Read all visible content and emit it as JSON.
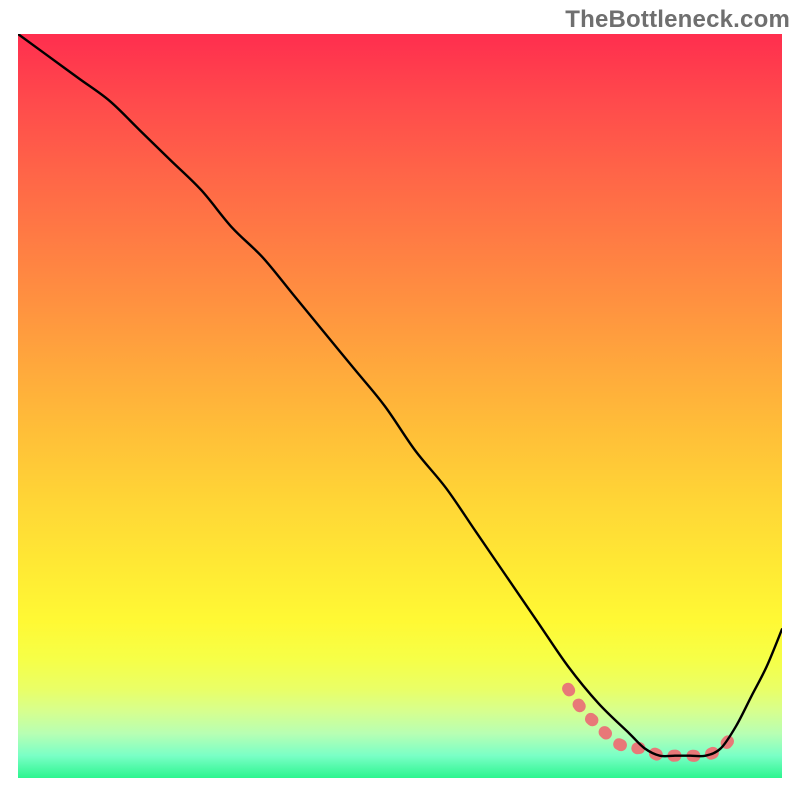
{
  "watermark": "TheBottleneck.com",
  "chart_data": {
    "type": "line",
    "title": "",
    "xlabel": "",
    "ylabel": "",
    "xlim": [
      0,
      100
    ],
    "ylim": [
      0,
      100
    ],
    "grid": false,
    "legend": false,
    "series": [
      {
        "name": "black-curve",
        "color": "#000000",
        "x": [
          0,
          4,
          8,
          12,
          16,
          20,
          24,
          28,
          32,
          36,
          40,
          44,
          48,
          52,
          56,
          60,
          64,
          68,
          72,
          76,
          80,
          82,
          84,
          86,
          88,
          90,
          92,
          94,
          96,
          98,
          100
        ],
        "y": [
          100,
          97,
          94,
          91,
          87,
          83,
          79,
          74,
          70,
          65,
          60,
          55,
          50,
          44,
          39,
          33,
          27,
          21,
          15,
          10,
          6,
          4,
          3,
          3,
          3,
          3,
          4,
          7,
          11,
          15,
          20
        ]
      },
      {
        "name": "pink-overlay-segment",
        "color": "#e87878",
        "x": [
          72,
          74,
          76,
          78,
          80,
          82,
          84,
          86,
          88,
          90,
          92,
          93
        ],
        "y": [
          12,
          9,
          7,
          5,
          4,
          4,
          3,
          3,
          3,
          3,
          4,
          5
        ]
      }
    ],
    "annotations": []
  }
}
